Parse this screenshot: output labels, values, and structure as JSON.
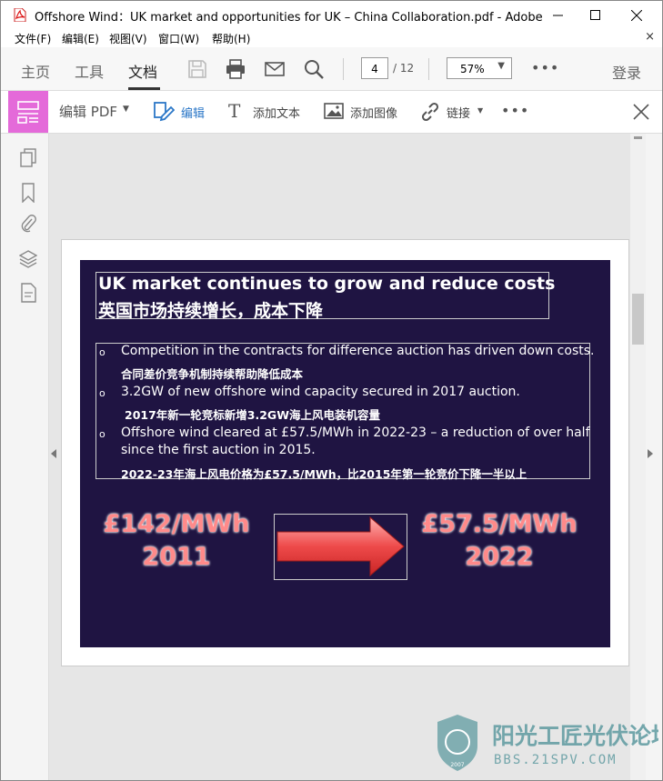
{
  "window": {
    "title": "Offshore Wind：UK market and opportunities for UK – China Collaboration.pdf - Adobe Acr...",
    "controls": [
      "minimize-button",
      "maximize-button",
      "close-button"
    ]
  },
  "menu": {
    "items": [
      "文件(F)",
      "编辑(E)",
      "视图(V)",
      "窗口(W)",
      "帮助(H)"
    ],
    "close_glyph": "×"
  },
  "toolbar": {
    "tabs": [
      "主页",
      "工具",
      "文档"
    ],
    "active_tab": "文档",
    "page_current": "4",
    "page_total": "/ 12",
    "zoom": "57%",
    "more": "•••",
    "login": "登录"
  },
  "edit_toolbar": {
    "edit_pdf": "编辑 PDF",
    "edit": "编辑",
    "add_text": "添加文本",
    "add_image": "添加图像",
    "link": "链接",
    "more": "•••"
  },
  "slide": {
    "title_en": "UK market continues to grow and reduce costs",
    "title_cn": "英国市场持续增长，成本下降",
    "bullets": [
      {
        "en": "Competition in the contracts for difference auction has driven down costs.",
        "cn": "合同差价竞争机制持续帮助降低成本"
      },
      {
        "en": "3.2GW of new offshore wind capacity secured in 2017 auction.",
        "cn": "2017年新一轮竞标新增3.2GW海上风电装机容量"
      },
      {
        "en": "Offshore wind cleared at £57.5/MWh in 2022-23 – a reduction of over half",
        "en2": "since the first auction in 2015.",
        "cn": "2022-23年海上风电价格为£57.5/MWh，比2015年第一轮竞价下降一半以上"
      }
    ],
    "bullet_glyph": "o",
    "left_price": "£142/MWh",
    "left_year": "2011",
    "right_price": "£57.5/MWh",
    "right_year": "2022"
  },
  "watermark": {
    "text_cn": "阳光工匠光伏论坛",
    "url": "BBS.21SPV.COM",
    "year": "2007"
  },
  "colors": {
    "slide_bg": "#1f1442",
    "edit_badge": "#e46ad9",
    "accent_blue": "#2b77c7",
    "price_red": "#ff8a8a"
  }
}
